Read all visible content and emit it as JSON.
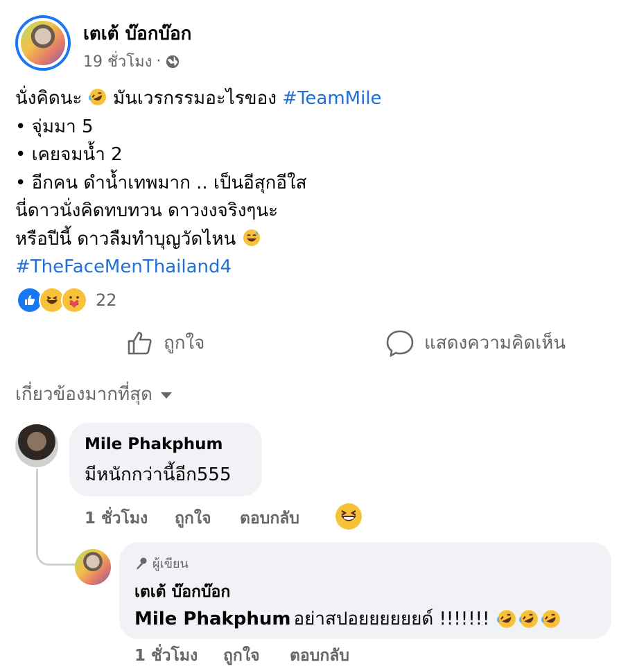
{
  "post": {
    "author": "เตเต้ บ๊อกบ๊อก",
    "time": "19 ชั่วโมง",
    "separator": "·",
    "privacy_icon": "globe-icon",
    "lines": {
      "l1_text": "นั่งคิดนะ",
      "l1_text2": "มันเวรกรรมอะไรของ",
      "l1_hashtag": "#TeamMile",
      "l2": "• จุ่มมา 5",
      "l3": "• เคยจมน้ำ 2",
      "l4": "• อีกคน ดำน้ำเทพมาก .. เป็นอีสุกอีใส",
      "l5": "นี่ดาวนั่งคิดทบทวน ดาวงงจริงๆนะ",
      "l6_text": "หรือปีนี้ ดาวลืมทำบุญวัดไหน",
      "l7_hashtag": "#TheFaceMenThailand4"
    },
    "reaction_count": "22",
    "reaction_icons": [
      "like-icon",
      "haha-icon",
      "care-icon"
    ],
    "actions": {
      "like": "ถูกใจ",
      "comment": "แสดงความคิดเห็น"
    },
    "sort_label": "เกี่ยวข้องมากที่สุด"
  },
  "comments": [
    {
      "name": "Mile Phakphum",
      "text": "มีหนักกว่านี้อีก555",
      "time": "1 ชั่วโมง",
      "like": "ถูกใจ",
      "reply": "ตอบกลับ",
      "reaction_icon": "haha-icon"
    },
    {
      "author_tag": "ผู้เขียน",
      "name": "เตเต้ บ๊อกบ๊อก",
      "mention": "Mile Phakphum",
      "text": "อย่าสปอยยยยยยด์ !!!!!!!",
      "time": "1 ชั่วโมง",
      "like": "ถูกใจ",
      "reply": "ตอบกลับ"
    }
  ],
  "colors": {
    "accent": "#1877f2",
    "hashtag": "#216fdb",
    "secondary_text": "#65676b",
    "bubble": "#f0f2f5"
  }
}
